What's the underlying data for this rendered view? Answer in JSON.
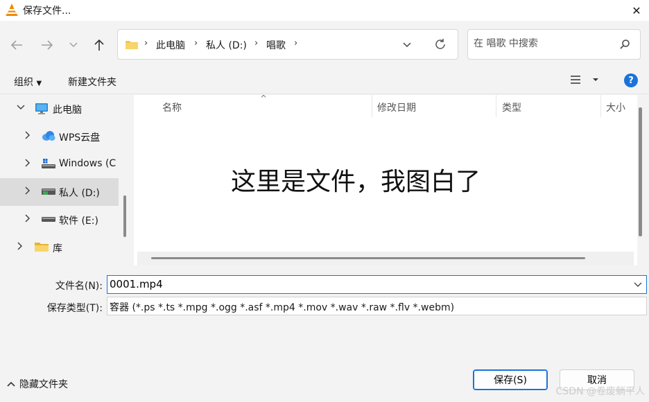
{
  "window": {
    "title": "保存文件...",
    "close_glyph": "✕"
  },
  "nav": {
    "breadcrumbs": [
      "此电脑",
      "私人 (D:)",
      "唱歌"
    ],
    "search_placeholder": "在 唱歌 中搜索"
  },
  "toolbar": {
    "organize_label": "组织",
    "new_folder_label": "新建文件夹"
  },
  "tree": {
    "items": [
      {
        "label": "此电脑",
        "icon": "computer-icon"
      },
      {
        "label": "WPS云盘",
        "icon": "cloud-icon"
      },
      {
        "label": "Windows (C",
        "icon": "drive-icon"
      },
      {
        "label": "私人 (D:)",
        "icon": "drive-icon"
      },
      {
        "label": "软件 (E:)",
        "icon": "drive-icon"
      },
      {
        "label": "库",
        "icon": "folder-icon"
      }
    ]
  },
  "files": {
    "columns": [
      "名称",
      "修改日期",
      "类型",
      "大小"
    ],
    "placeholder_text": "这里是文件，我图白了"
  },
  "form": {
    "filename_label": "文件名(N):",
    "filename_value": "0001.mp4",
    "filetype_label": "保存类型(T):",
    "filetype_value": "容器 (*.ps *.ts *.mpg *.ogg *.asf *.mp4 *.mov *.wav *.raw *.flv *.webm)"
  },
  "footer": {
    "hide_folders_label": "隐藏文件夹",
    "save_label": "保存(S)",
    "cancel_label": "取消",
    "watermark": "CSDN @卷废躺平人"
  },
  "colors": {
    "accent": "#1a73d9",
    "selection": "#dcdcdc"
  }
}
